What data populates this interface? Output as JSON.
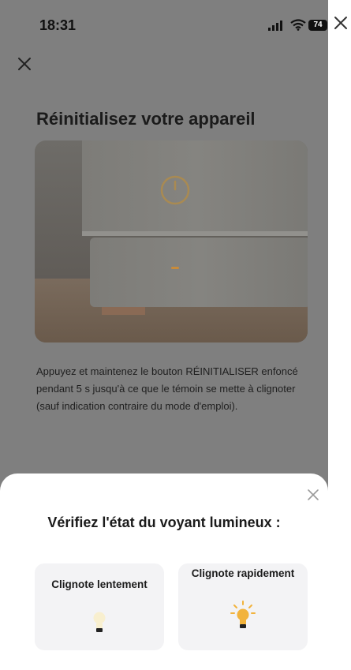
{
  "status_bar": {
    "time": "18:31",
    "battery": "74"
  },
  "page": {
    "title": "Réinitialisez votre appareil",
    "description": "Appuyez et maintenez le bouton RÉINITIALISER enfoncé pendant 5 s jusqu'à ce que le témoin se mette à clignoter (sauf indication contraire du mode d'emploi)."
  },
  "sheet": {
    "title": "Vérifiez l'état du voyant lumineux :",
    "options": [
      {
        "label": "Clignote lentement",
        "icon": "bulb-dim-icon"
      },
      {
        "label": "Clignote rapidement",
        "icon": "bulb-bright-icon"
      }
    ]
  },
  "colors": {
    "overlay": "#7f7f7f",
    "accent": "#f2b33c",
    "card": "#f3f3f5"
  }
}
